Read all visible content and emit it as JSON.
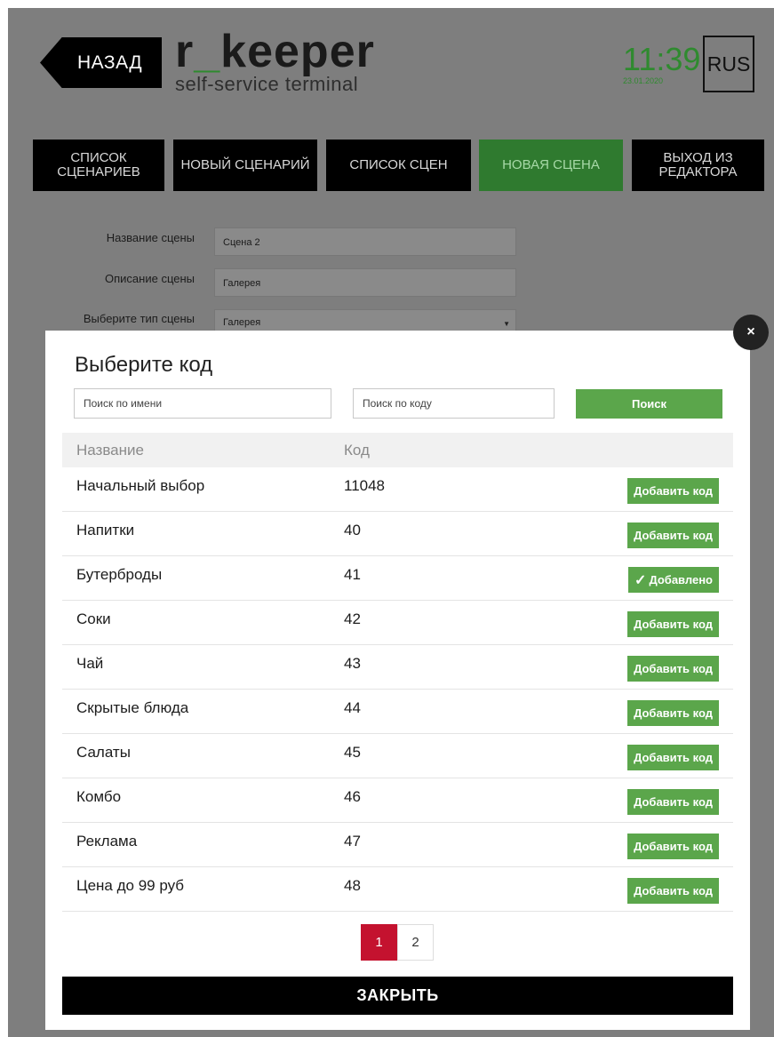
{
  "header": {
    "back_label": "НАЗАД",
    "brand_pre": "r",
    "brand_sep": "_",
    "brand_post": "keeper",
    "brand_subtitle": "self-service terminal",
    "time": "11:39",
    "date": "23.01.2020",
    "language": "RUS"
  },
  "nav": {
    "items": [
      {
        "label": "СПИСОК СЦЕНАРИЕВ",
        "active": false
      },
      {
        "label": "НОВЫЙ СЦЕНАРИЙ",
        "active": false
      },
      {
        "label": "СПИСОК СЦЕН",
        "active": false
      },
      {
        "label": "НОВАЯ СЦЕНА",
        "active": true
      },
      {
        "label": "ВЫХОД ИЗ РЕДАКТОРА",
        "active": false
      }
    ]
  },
  "form": {
    "name_label": "Название сцены",
    "name_value": "Сцена 2",
    "desc_label": "Описание сцены",
    "desc_value": "Галерея",
    "type_label": "Выберите тип сцены",
    "type_value": "Галерея"
  },
  "modal": {
    "title": "Выберите код",
    "search_name_placeholder": "Поиск по имени",
    "search_code_placeholder": "Поиск по коду",
    "search_button": "Поиск",
    "col_name": "Название",
    "col_code": "Код",
    "rows": [
      {
        "name": "Начальный выбор",
        "code": "11048",
        "action": "Добавить код"
      },
      {
        "name": "Напитки",
        "code": "40",
        "action": "Добавить код"
      },
      {
        "name": "Бутерброды",
        "code": "41",
        "action": "Добавлено"
      },
      {
        "name": "Соки",
        "code": "42",
        "action": "Добавить код"
      },
      {
        "name": "Чай",
        "code": "43",
        "action": "Добавить код"
      },
      {
        "name": "Скрытые блюда",
        "code": "44",
        "action": "Добавить код"
      },
      {
        "name": "Салаты",
        "code": "45",
        "action": "Добавить код"
      },
      {
        "name": "Комбо",
        "code": "46",
        "action": "Добавить код"
      },
      {
        "name": "Реклама",
        "code": "47",
        "action": "Добавить код"
      },
      {
        "name": "Цена до 99 руб",
        "code": "48",
        "action": "Добавить код"
      }
    ],
    "pages": [
      "1",
      "2"
    ],
    "current_page": "1",
    "close_label": "ЗАКРЫТЬ",
    "close_x": "×"
  },
  "colors": {
    "accent_green": "#5ba64b",
    "active_page": "#c4122f",
    "clock_green": "#2f8a2f"
  }
}
